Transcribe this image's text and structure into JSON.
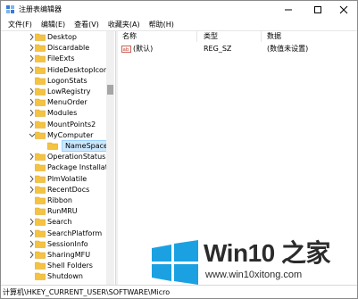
{
  "window": {
    "title": "注册表编辑器"
  },
  "menu": [
    "文件(F)",
    "编辑(E)",
    "查看(V)",
    "收藏夹(A)",
    "帮助(H)"
  ],
  "tree": {
    "items": [
      {
        "label": "Desktop",
        "expandable": true
      },
      {
        "label": "Discardable",
        "expandable": true
      },
      {
        "label": "FileExts",
        "expandable": true
      },
      {
        "label": "HideDesktopIcons",
        "expandable": true
      },
      {
        "label": "LogonStats",
        "expandable": false
      },
      {
        "label": "LowRegistry",
        "expandable": true
      },
      {
        "label": "MenuOrder",
        "expandable": true
      },
      {
        "label": "Modules",
        "expandable": true
      },
      {
        "label": "MountPoints2",
        "expandable": true
      },
      {
        "label": "MyComputer",
        "expandable": true,
        "expanded": true
      },
      {
        "label": "NameSpace",
        "expandable": false,
        "selected": true,
        "child": true
      },
      {
        "label": "OperationStatusMa",
        "expandable": true
      },
      {
        "label": "Package Installatio",
        "expandable": false
      },
      {
        "label": "PlmVolatile",
        "expandable": true
      },
      {
        "label": "RecentDocs",
        "expandable": true
      },
      {
        "label": "Ribbon",
        "expandable": false
      },
      {
        "label": "RunMRU",
        "expandable": false
      },
      {
        "label": "Search",
        "expandable": true
      },
      {
        "label": "SearchPlatform",
        "expandable": true
      },
      {
        "label": "SessionInfo",
        "expandable": true
      },
      {
        "label": "SharingMFU",
        "expandable": true
      },
      {
        "label": "Shell Folders",
        "expandable": false
      },
      {
        "label": "Shutdown",
        "expandable": false
      }
    ]
  },
  "list": {
    "headers": {
      "name": "名称",
      "type": "类型",
      "data": "数据"
    },
    "rows": [
      {
        "name": "(默认)",
        "type": "REG_SZ",
        "data": "(数值未设置)"
      }
    ]
  },
  "status": {
    "path": "计算机\\HKEY_CURRENT_USER\\SOFTWARE\\Micro"
  },
  "watermark": {
    "title": "Win10 之家",
    "url": "www.win10xitong.com"
  },
  "colors": {
    "folder": "#f5c342",
    "selection": "#cce8ff",
    "logo_blue": "#1ba1e2"
  }
}
